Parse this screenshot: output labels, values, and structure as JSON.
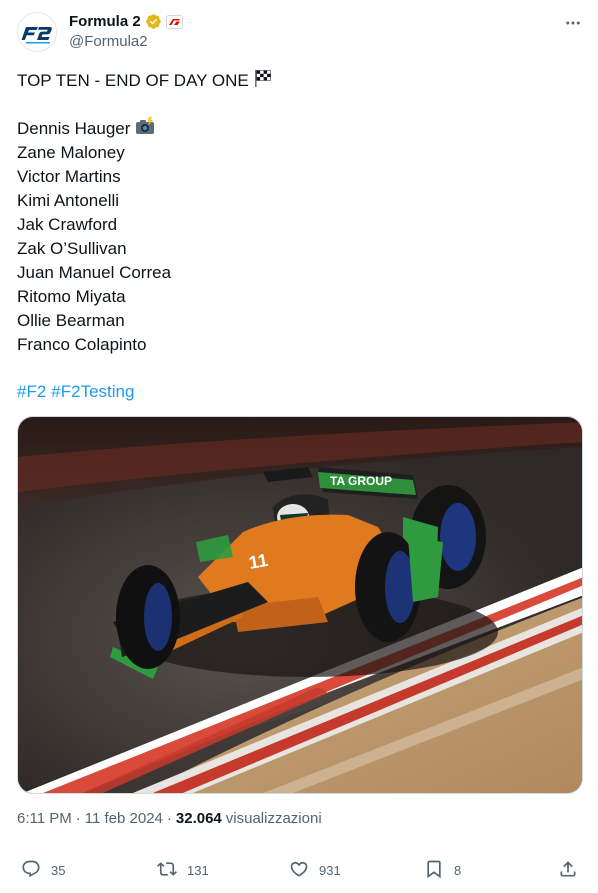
{
  "author": {
    "display_name": "Formula 2",
    "handle": "@Formula2",
    "avatar_text": "F2",
    "verified_icon": "gold-verified-badge-icon",
    "affiliate_icon": "f1-affiliate-badge-icon"
  },
  "tweet": {
    "heading": "TOP TEN - END OF DAY ONE",
    "heading_emoji": "chequered-flag-icon",
    "drivers": [
      "Dennis Hauger",
      "Zane Maloney",
      "Victor Martins",
      "Kimi Antonelli",
      "Jak Crawford",
      "Zak O’Sullivan",
      "Juan Manuel Correa",
      "Ritomo Miyata",
      "Ollie Bearman",
      "Franco Colapinto"
    ],
    "first_driver_emoji": "camera-with-flash-icon",
    "hashtags": [
      "#F2",
      "#F2Testing"
    ]
  },
  "media": {
    "car_number": "11",
    "sponsor_text": "TA GROUP"
  },
  "meta": {
    "time": "6:11 PM",
    "separator": "·",
    "date": "11 feb 2024",
    "views_count": "32.064",
    "views_label": "visualizzazioni"
  },
  "actions": {
    "replies": "35",
    "reposts": "131",
    "likes": "931",
    "bookmarks": "8"
  },
  "colors": {
    "accent": "#1d9bf0",
    "secondary_text": "#536471",
    "primary_text": "#0f1419"
  }
}
